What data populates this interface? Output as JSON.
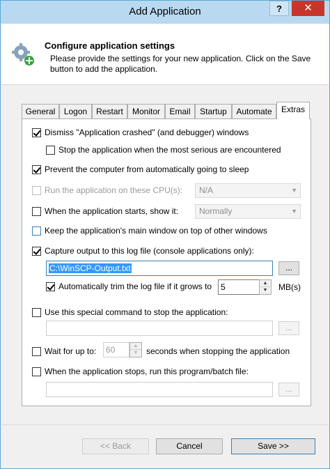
{
  "window": {
    "title": "Add Application",
    "help_label": "?",
    "close_label": "✕"
  },
  "header": {
    "title": "Configure application settings",
    "description": "Please provide the settings for your new application. Click on the Save button to add the application."
  },
  "tabs": [
    "General",
    "Logon",
    "Restart",
    "Monitor",
    "Email",
    "Startup",
    "Automate",
    "Extras"
  ],
  "active_tab": "Extras",
  "options": {
    "dismiss_crash": {
      "label": "Dismiss \"Application crashed\" (and debugger) windows",
      "checked": true
    },
    "stop_on_serious": {
      "label": "Stop the application when the most serious are encountered",
      "checked": false
    },
    "prevent_sleep": {
      "label": "Prevent the computer from automatically going to sleep",
      "checked": true
    },
    "cpu_affinity": {
      "label": "Run the application on these CPU(s):",
      "checked": false,
      "value": "N/A"
    },
    "show_on_start": {
      "label": "When the application starts, show it:",
      "checked": false,
      "value": "Normally"
    },
    "keep_on_top": {
      "label": "Keep the application's main window on top of other windows",
      "checked": false
    },
    "capture_output": {
      "label": "Capture output to this log file (console applications only):",
      "checked": true,
      "path": "C:\\WinSCP-Output.txt",
      "browse": "..."
    },
    "trim_log": {
      "label": "Automatically trim the log file if it grows to",
      "checked": true,
      "value": "5",
      "unit": "MB(s)"
    },
    "stop_command": {
      "label": "Use this special command to stop the application:",
      "checked": false,
      "value": "",
      "browse": "..."
    },
    "wait_stop": {
      "label_before": "Wait for up to:",
      "checked": false,
      "value": "60",
      "label_after": "seconds when stopping the application"
    },
    "run_on_stop": {
      "label": "When the application stops, run this program/batch file:",
      "checked": false,
      "value": "",
      "browse": "..."
    }
  },
  "buttons": {
    "back": "<< Back",
    "cancel": "Cancel",
    "save": "Save >>"
  }
}
